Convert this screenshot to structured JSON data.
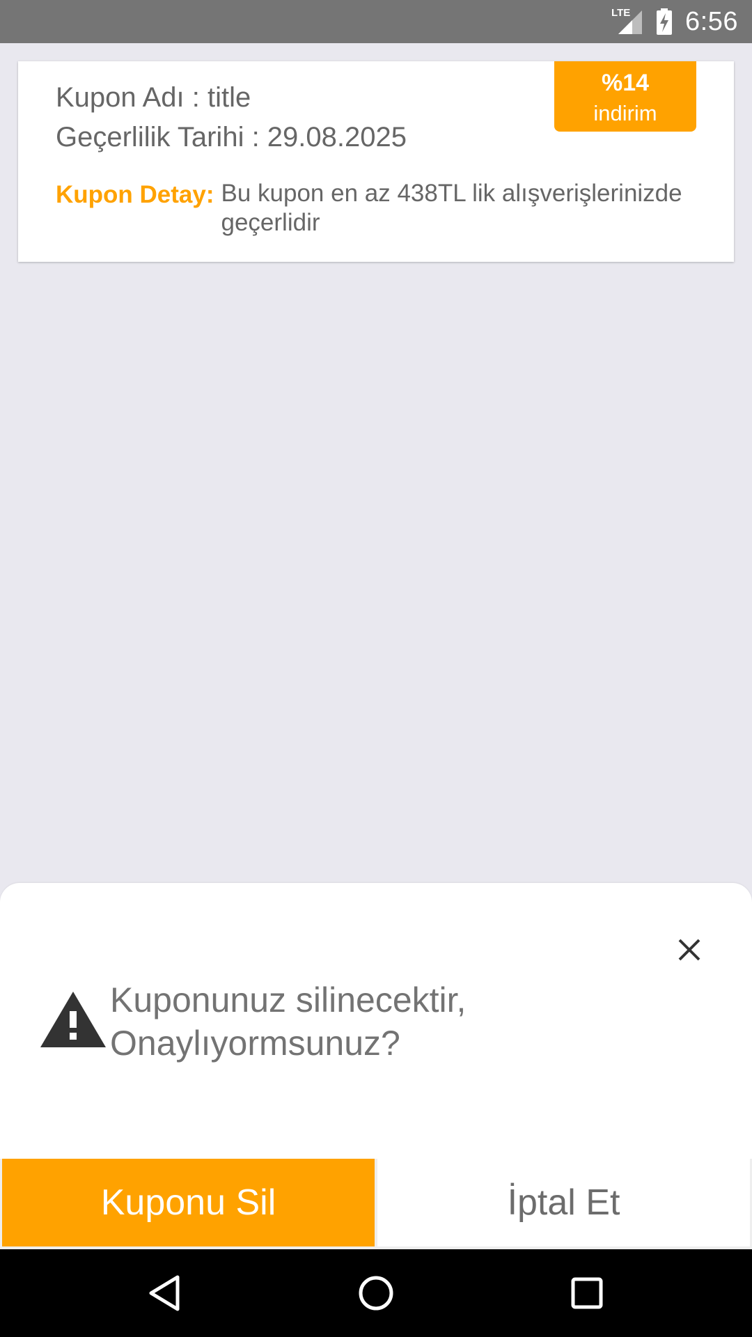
{
  "status_bar": {
    "network_label": "LTE",
    "time": "6:56",
    "icons": [
      "lte-signal-icon",
      "battery-charging-icon"
    ]
  },
  "coupon": {
    "name_line": "Kupon Adı : title",
    "validity_line": "Geçerlilik Tarihi : 29.08.2025",
    "detail_label": "Kupon Detay:",
    "detail_text": "Bu kupon en az 438TL lik alışverişlerinizde geçerlidir",
    "discount_value": "%14",
    "discount_label": "indirim"
  },
  "dialog": {
    "message_line1": "Kuponunuz silinecektir,",
    "message_line2": "Onaylıyormsunuz?",
    "delete_label": "Kuponu Sil",
    "cancel_label": "İptal Et",
    "icons": [
      "close-icon",
      "warning-icon"
    ]
  },
  "nav_bar": {
    "icons": [
      "back-icon",
      "home-icon",
      "recent-apps-icon"
    ]
  },
  "colors": {
    "accent": "#ffa200",
    "status_bar": "#757575",
    "background": "#e9e8ef",
    "nav_bar": "#000000"
  }
}
